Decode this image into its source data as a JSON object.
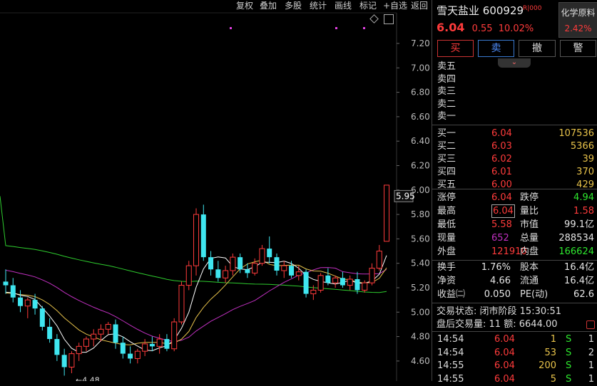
{
  "toolbar": [
    "复权",
    "叠加",
    "多股",
    "统计",
    "画线",
    "标记",
    "+自选",
    "返回"
  ],
  "chart_data": {
    "type": "candlestick",
    "y_ticks": [
      "7.20",
      "7.00",
      "6.80",
      "6.60",
      "6.40",
      "6.20",
      "6.00",
      "5.80",
      "5.60",
      "5.40",
      "5.20",
      "5.00",
      "4.80",
      "4.60"
    ],
    "ylim": [
      4.55,
      7.3
    ],
    "last_price_marker": "5.95",
    "low_annotation": "4.48",
    "candles": [
      {
        "o": 5.25,
        "h": 5.35,
        "l": 5.15,
        "c": 5.22
      },
      {
        "o": 5.22,
        "h": 5.28,
        "l": 5.08,
        "c": 5.12
      },
      {
        "o": 5.12,
        "h": 5.18,
        "l": 5.0,
        "c": 5.05
      },
      {
        "o": 5.05,
        "h": 5.12,
        "l": 4.95,
        "c": 5.1
      },
      {
        "o": 5.1,
        "h": 5.15,
        "l": 4.98,
        "c": 5.03
      },
      {
        "o": 5.03,
        "h": 5.05,
        "l": 4.85,
        "c": 4.88
      },
      {
        "o": 4.88,
        "h": 4.95,
        "l": 4.75,
        "c": 4.78
      },
      {
        "o": 4.78,
        "h": 4.82,
        "l": 4.6,
        "c": 4.65
      },
      {
        "o": 4.65,
        "h": 4.7,
        "l": 4.48,
        "c": 4.55
      },
      {
        "o": 4.55,
        "h": 4.68,
        "l": 4.5,
        "c": 4.66
      },
      {
        "o": 4.66,
        "h": 4.75,
        "l": 4.6,
        "c": 4.72
      },
      {
        "o": 4.72,
        "h": 4.8,
        "l": 4.68,
        "c": 4.78
      },
      {
        "o": 4.78,
        "h": 4.86,
        "l": 4.72,
        "c": 4.82
      },
      {
        "o": 4.82,
        "h": 4.9,
        "l": 4.76,
        "c": 4.86
      },
      {
        "o": 4.86,
        "h": 4.92,
        "l": 4.82,
        "c": 4.9
      },
      {
        "o": 4.9,
        "h": 4.94,
        "l": 4.7,
        "c": 4.75
      },
      {
        "o": 4.75,
        "h": 4.8,
        "l": 4.62,
        "c": 4.66
      },
      {
        "o": 4.66,
        "h": 4.72,
        "l": 4.58,
        "c": 4.62
      },
      {
        "o": 4.62,
        "h": 4.7,
        "l": 4.58,
        "c": 4.68
      },
      {
        "o": 4.68,
        "h": 4.78,
        "l": 4.64,
        "c": 4.74
      },
      {
        "o": 4.74,
        "h": 4.8,
        "l": 4.68,
        "c": 4.72
      },
      {
        "o": 4.72,
        "h": 4.82,
        "l": 4.66,
        "c": 4.78
      },
      {
        "o": 4.78,
        "h": 4.82,
        "l": 4.68,
        "c": 4.7
      },
      {
        "o": 4.7,
        "h": 4.95,
        "l": 4.68,
        "c": 4.92
      },
      {
        "o": 4.92,
        "h": 5.25,
        "l": 4.9,
        "c": 5.22
      },
      {
        "o": 5.22,
        "h": 5.42,
        "l": 5.18,
        "c": 5.38
      },
      {
        "o": 5.38,
        "h": 5.85,
        "l": 5.3,
        "c": 5.8
      },
      {
        "o": 5.8,
        "h": 5.88,
        "l": 5.42,
        "c": 5.45
      },
      {
        "o": 5.45,
        "h": 5.5,
        "l": 5.3,
        "c": 5.35
      },
      {
        "o": 5.35,
        "h": 5.42,
        "l": 5.25,
        "c": 5.28
      },
      {
        "o": 5.28,
        "h": 5.38,
        "l": 5.24,
        "c": 5.34
      },
      {
        "o": 5.34,
        "h": 5.48,
        "l": 5.3,
        "c": 5.45
      },
      {
        "o": 5.45,
        "h": 5.48,
        "l": 5.32,
        "c": 5.35
      },
      {
        "o": 5.35,
        "h": 5.4,
        "l": 5.28,
        "c": 5.32
      },
      {
        "o": 5.32,
        "h": 5.44,
        "l": 5.3,
        "c": 5.4
      },
      {
        "o": 5.4,
        "h": 5.55,
        "l": 5.38,
        "c": 5.52
      },
      {
        "o": 5.52,
        "h": 5.62,
        "l": 5.4,
        "c": 5.45
      },
      {
        "o": 5.45,
        "h": 5.48,
        "l": 5.3,
        "c": 5.34
      },
      {
        "o": 5.34,
        "h": 5.42,
        "l": 5.28,
        "c": 5.38
      },
      {
        "o": 5.38,
        "h": 5.42,
        "l": 5.28,
        "c": 5.3
      },
      {
        "o": 5.3,
        "h": 5.38,
        "l": 5.26,
        "c": 5.33
      },
      {
        "o": 5.33,
        "h": 5.35,
        "l": 5.12,
        "c": 5.15
      },
      {
        "o": 5.15,
        "h": 5.22,
        "l": 5.1,
        "c": 5.18
      },
      {
        "o": 5.18,
        "h": 5.32,
        "l": 5.16,
        "c": 5.3
      },
      {
        "o": 5.3,
        "h": 5.36,
        "l": 5.22,
        "c": 5.24
      },
      {
        "o": 5.24,
        "h": 5.3,
        "l": 5.2,
        "c": 5.28
      },
      {
        "o": 5.28,
        "h": 5.33,
        "l": 5.2,
        "c": 5.22
      },
      {
        "o": 5.22,
        "h": 5.3,
        "l": 5.18,
        "c": 5.27
      },
      {
        "o": 5.27,
        "h": 5.33,
        "l": 5.15,
        "c": 5.18
      },
      {
        "o": 5.18,
        "h": 5.26,
        "l": 5.16,
        "c": 5.24
      },
      {
        "o": 5.24,
        "h": 5.4,
        "l": 5.22,
        "c": 5.36
      },
      {
        "o": 5.36,
        "h": 5.55,
        "l": 5.34,
        "c": 5.5
      },
      {
        "o": 5.58,
        "h": 6.04,
        "l": 5.58,
        "c": 6.04
      }
    ]
  },
  "quote": {
    "name": "雪天盐业",
    "code": "600929",
    "tag": "R|000",
    "price": "6.04",
    "change": "0.55",
    "change_pct": "10.02%",
    "sector_name": "化学原料",
    "sector_pct": "2.42%"
  },
  "actions": [
    "买",
    "卖",
    "撤",
    "警"
  ],
  "sell_labels": [
    "卖五",
    "卖四",
    "卖三",
    "卖二",
    "卖一"
  ],
  "buy_book": [
    {
      "label": "买一",
      "price": "6.04",
      "vol": "107536"
    },
    {
      "label": "买二",
      "price": "6.03",
      "vol": "5366"
    },
    {
      "label": "买三",
      "price": "6.02",
      "vol": "39"
    },
    {
      "label": "买四",
      "price": "6.01",
      "vol": "370"
    },
    {
      "label": "买五",
      "price": "6.00",
      "vol": "429"
    }
  ],
  "stats1": [
    {
      "l1": "涨停",
      "v1": "6.04",
      "l2": "跌停",
      "v2": "4.94"
    },
    {
      "l1": "最高",
      "v1": "6.04",
      "l2": "量比",
      "v2": "1.58"
    },
    {
      "l1": "最低",
      "v1": "5.58",
      "l2": "市值",
      "v2": "99.1亿"
    },
    {
      "l1": "现量",
      "v1": "652",
      "l2": "总量",
      "v2": "288534"
    },
    {
      "l1": "外盘",
      "v1": "121910",
      "l2": "内盘",
      "v2": "166624"
    }
  ],
  "stats2": [
    {
      "l1": "换手",
      "v1": "1.76%",
      "l2": "股本",
      "v2": "16.4亿"
    },
    {
      "l1": "净资",
      "v1": "4.66",
      "l2": "流通",
      "v2": "16.4亿"
    },
    {
      "l1": "收益㈡",
      "v1": "0.050",
      "l2": "PE(动)",
      "v2": "62.6"
    }
  ],
  "status": {
    "label": "交易状态:",
    "value": "闭市阶段 15:30:51"
  },
  "after_hours": {
    "label": "盘后交易量:",
    "vol": "11",
    "amt_label": "额:",
    "amt": "6644.00"
  },
  "ticks": [
    {
      "time": "14:54",
      "price": "6.04",
      "vol": "1",
      "side": "S",
      "n": "1"
    },
    {
      "time": "14:54",
      "price": "6.04",
      "vol": "53",
      "side": "S",
      "n": "2"
    },
    {
      "time": "14:55",
      "price": "6.04",
      "vol": "200",
      "side": "S",
      "n": "1"
    },
    {
      "time": "14:55",
      "price": "6.04",
      "vol": "5",
      "side": "S",
      "n": "1"
    }
  ]
}
